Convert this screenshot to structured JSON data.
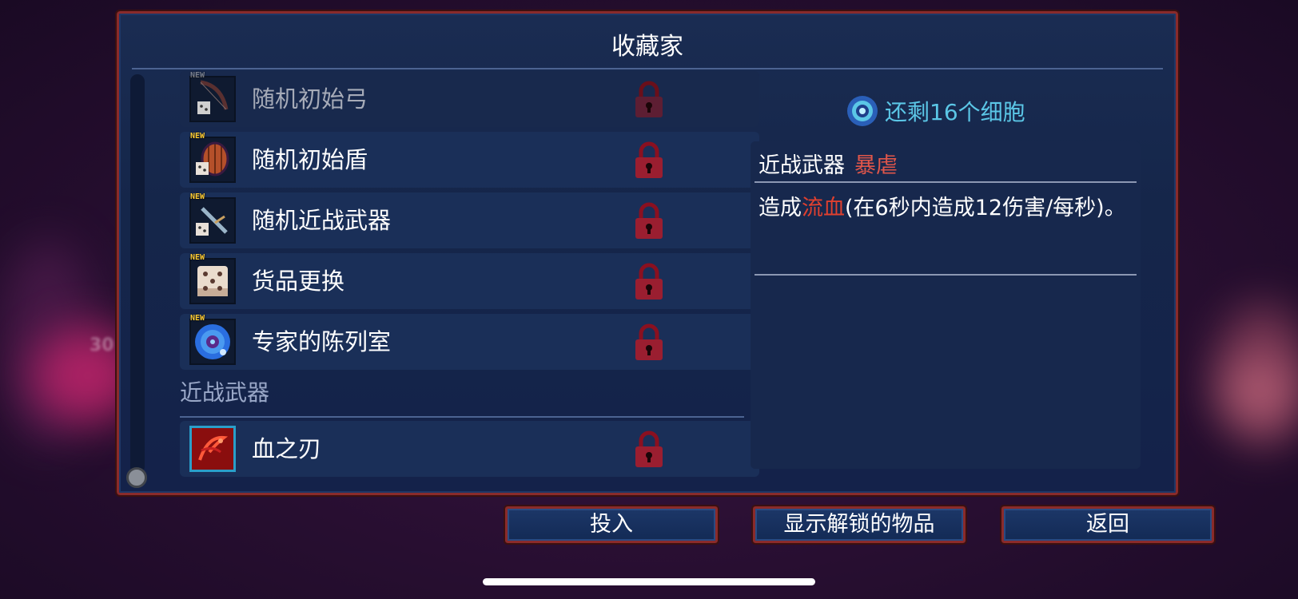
{
  "panel": {
    "title": "收藏家"
  },
  "list": {
    "items": [
      {
        "label": "随机初始弓",
        "new_tag": "NEW",
        "state": "faded",
        "icon": "random-bow-icon"
      },
      {
        "label": "随机初始盾",
        "new_tag": "NEW",
        "state": "normal",
        "icon": "random-shield-icon"
      },
      {
        "label": "随机近战武器",
        "new_tag": "NEW",
        "state": "normal",
        "icon": "random-melee-icon"
      },
      {
        "label": "货品更换",
        "new_tag": "NEW",
        "state": "normal",
        "icon": "dice-icon"
      },
      {
        "label": "专家的陈列室",
        "new_tag": "NEW",
        "state": "normal",
        "icon": "blue-orb-icon"
      }
    ],
    "section": {
      "header": "近战武器",
      "items": [
        {
          "label": "血之刃",
          "state": "selected",
          "icon": "blood-sword-icon"
        }
      ]
    }
  },
  "detail": {
    "cells_text": "还剩16个细胞",
    "category": "近战武器",
    "tag": "暴虐",
    "desc_prefix": "造成",
    "desc_keyword": "流血",
    "desc_suffix": "(在6秒内造成12伤害/每秒)。"
  },
  "buttons": {
    "invest": "投入",
    "show_unlocked": "显示解锁的物品",
    "back": "返回"
  },
  "background": {
    "blurred_number": "30"
  },
  "colors": {
    "frame": "#8a2b2b",
    "panel": "#1a2c52",
    "accent_cyan": "#5bc6e6",
    "accent_red": "#e0402f"
  }
}
